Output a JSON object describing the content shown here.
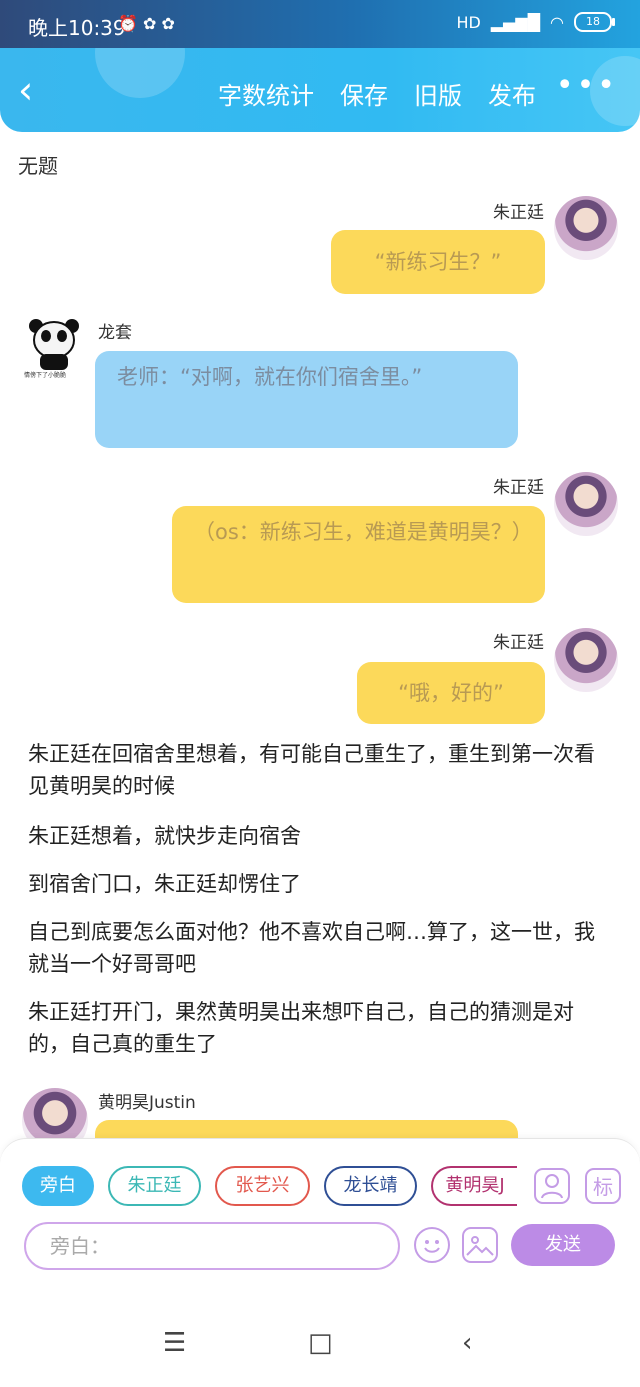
{
  "status": {
    "time": "晚上10:39",
    "battery": "18",
    "net": "HD"
  },
  "header": {
    "back_label": "‹",
    "nav": [
      "字数统计",
      "保存",
      "旧版",
      "发布"
    ],
    "more": "•••"
  },
  "doc": {
    "title": "无题"
  },
  "messages": [
    {
      "speaker": "朱正廷",
      "text": "“新练习生？”"
    },
    {
      "speaker": "龙套",
      "text": "老师：“对啊，就在你们宿舍里。”",
      "sticker_caption": "情傍下了小脆脆"
    },
    {
      "speaker": "朱正廷",
      "text": "（os：新练习生，难道是黄明昊？）"
    },
    {
      "speaker": "朱正廷",
      "text": "“哦，好的”"
    }
  ],
  "narration": [
    "朱正廷在回宿舍里想着，有可能自己重生了，重生到第一次看见黄明昊的时候",
    "朱正廷想着，就快步走向宿舍",
    "到宿舍门口，朱正廷却愣住了",
    "自己到底要怎么面对他？他不喜欢自己啊…算了，这一世，我就当一个好哥哥吧",
    "朱正廷打开门，果然黄明昊出来想吓自己，自己的猜测是对的，自己真的重生了"
  ],
  "last_message": {
    "speaker": "黄明昊Justin"
  },
  "roles": [
    {
      "label": "旁白",
      "color": "#3db9ef"
    },
    {
      "label": "朱正廷",
      "color": "#3cb8b5"
    },
    {
      "label": "张艺兴",
      "color": "#e2584d"
    },
    {
      "label": "龙长靖",
      "color": "#2f4f95"
    },
    {
      "label": "黄明昊J",
      "color": "#b2326f"
    }
  ],
  "tools": {
    "role_icon": "person-icon",
    "tag": "标"
  },
  "input": {
    "placeholder": "旁白："
  },
  "send_label": "发送",
  "system_nav": {
    "menu": "☰",
    "home": "□",
    "back": "‹"
  }
}
